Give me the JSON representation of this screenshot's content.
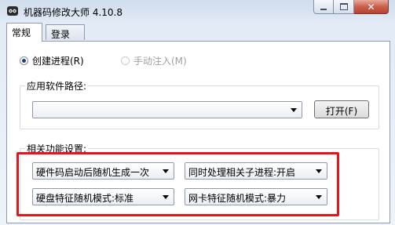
{
  "window": {
    "title": "机器码修改大师 4.10.8",
    "controls": {
      "minimize": "minimize-icon",
      "maximize": "maximize-icon",
      "close": "close-icon"
    }
  },
  "tabs": [
    {
      "label": "常规",
      "active": true
    },
    {
      "label": "登录",
      "active": false
    }
  ],
  "mode": {
    "create_process": {
      "label": "创建进程(R)",
      "selected": true
    },
    "manual_inject": {
      "label": "手动注入(M)",
      "selected": false,
      "enabled": false
    }
  },
  "app_path": {
    "group_title": "应用软件路径:",
    "value": "",
    "open_button": "打开(F)"
  },
  "features": {
    "group_title": "相关功能设置:",
    "hardware_code_option": "硬件码启动后随机生成一次",
    "related_process_option": "同时处理相关子进程:开启",
    "disk_mode_option": "硬盘特征随机模式:标准",
    "nic_mode_option": "网卡特征随机模式:暴力"
  },
  "colors": {
    "highlight_border": "#e5151a",
    "titlebar": "#cfdceb"
  }
}
